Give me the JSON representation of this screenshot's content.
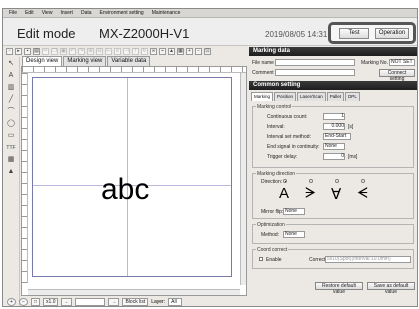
{
  "menu": [
    "File",
    "Edit",
    "View",
    "Insert",
    "Data",
    "Environment setting",
    "Maintenance"
  ],
  "header": {
    "mode": "Edit mode",
    "model": "MX-Z2000H-V1",
    "datetime": "2019/08/05 14:31:50",
    "test_label": "Test",
    "operation_label": "Operation"
  },
  "toolbar_icons": [
    "new-icon",
    "open-icon",
    "save-icon",
    "print-icon",
    "cut-icon",
    "copy-icon",
    "paste-icon",
    "undo-icon",
    "redo-icon",
    "group-icon",
    "ungroup-icon",
    "align-icon",
    "align-icon",
    "align-icon",
    "align-icon",
    "rotate-icon",
    "link-icon",
    "unlink-icon",
    "lock-icon",
    "image-icon",
    "zoom-icon",
    "zoom-icon",
    "zoom-icon"
  ],
  "tools": [
    "select-icon",
    "text-icon",
    "barcode-icon",
    "line-icon",
    "arc-icon",
    "circle-icon",
    "rectangle-icon",
    "ttf-icon",
    "logo-icon",
    "image-icon"
  ],
  "tools_glyphs": [
    "↖",
    "A",
    "▥",
    "╱",
    "⌒",
    "◯",
    "▭",
    "TTF",
    "▦",
    "▲"
  ],
  "view_tabs": [
    "Design view",
    "Marking view",
    "Variable data"
  ],
  "canvas": {
    "marking_text": "abc"
  },
  "bottombar": {
    "zoom": "x1.0",
    "block_list": "Block list",
    "layer_label": "Layer:",
    "layer_value": "All"
  },
  "marking_data": {
    "title": "Marking data",
    "file_name_label": "File name",
    "comment_label": "Comment",
    "marking_no_label": "Marking No.",
    "marking_no_value": "NOT SET",
    "connect_label": "Connect setting"
  },
  "common_setting": {
    "title": "Common setting",
    "tabs": [
      "Marking",
      "Position",
      "Laser/Scan",
      "Pallet",
      "DPL"
    ],
    "marking_control": {
      "title": "Marking control",
      "continuous_count_label": "Continuous count:",
      "continuous_count_value": "1",
      "interval_label": "Interval:",
      "interval_value": "0.000",
      "interval_unit": "[s]",
      "interval_set_label": "Interval set method:",
      "interval_set_value": "End-Start",
      "end_signal_label": "End signal in continuity:",
      "end_signal_value": "None",
      "trigger_delay_label": "Trigger delay:",
      "trigger_delay_value": "0",
      "trigger_delay_unit": "[ms]"
    },
    "marking_direction": {
      "title": "Marking direction",
      "direction_label": "Direction:",
      "glyphs": [
        "A",
        "ᗒ",
        "∀",
        "ᗕ"
      ],
      "mirror_label": "Mirror flip:",
      "mirror_value": "None"
    },
    "optimization": {
      "title": "Optimization",
      "method_label": "Method:",
      "method_value": "None"
    },
    "coord_correct": {
      "title": "Coord correct",
      "enable_label": "Enable",
      "correct_label": "Correct",
      "correct_value": "5x10(Spot)(Interval:10.0mm)"
    },
    "restore_label": "Restore default value",
    "save_label": "Save as default value"
  }
}
